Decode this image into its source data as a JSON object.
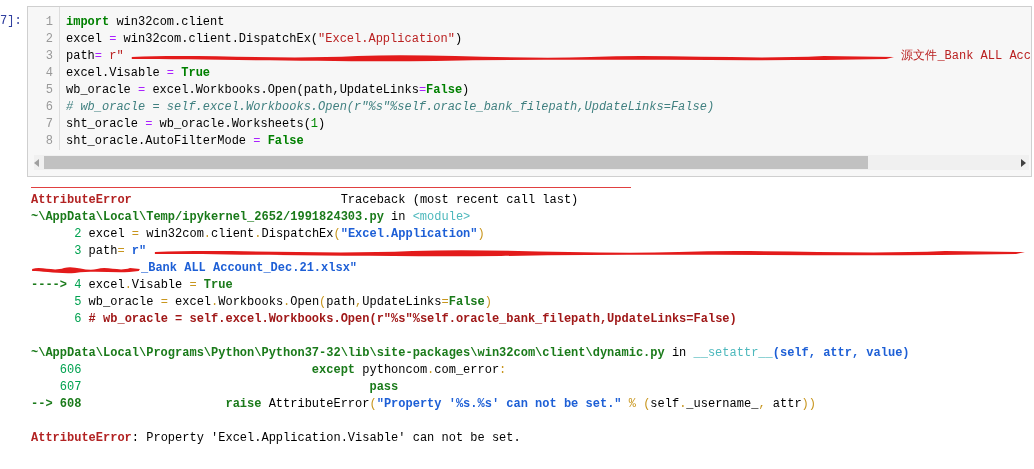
{
  "cell": {
    "prompt": "7]:",
    "lines": [
      {
        "number": "1",
        "tokens": [
          {
            "kind": "kw",
            "text": "import"
          },
          {
            "kind": "plain",
            "text": " win32com.client"
          }
        ]
      },
      {
        "number": "2",
        "tokens": [
          {
            "kind": "plain",
            "text": "excel "
          },
          {
            "kind": "op",
            "text": "="
          },
          {
            "kind": "plain",
            "text": " win32com.client.DispatchEx("
          },
          {
            "kind": "str",
            "text": "\"Excel.Application\""
          },
          {
            "kind": "plain",
            "text": ")"
          }
        ]
      },
      {
        "number": "3",
        "tokens": [
          {
            "kind": "plain",
            "text": "path"
          },
          {
            "kind": "op",
            "text": "="
          },
          {
            "kind": "str",
            "text": " r\""
          },
          {
            "kind": "redaction"
          },
          {
            "kind": "str",
            "text": "源文件_Bank ALL Acc"
          }
        ]
      },
      {
        "number": "4",
        "tokens": [
          {
            "kind": "plain",
            "text": "excel.Visable "
          },
          {
            "kind": "op",
            "text": "="
          },
          {
            "kind": "kw",
            "text": " True"
          }
        ]
      },
      {
        "number": "5",
        "tokens": [
          {
            "kind": "plain",
            "text": "wb_oracle "
          },
          {
            "kind": "op",
            "text": "="
          },
          {
            "kind": "plain",
            "text": " excel.Workbooks.Open(path,UpdateLinks"
          },
          {
            "kind": "op",
            "text": "="
          },
          {
            "kind": "kw",
            "text": "False"
          },
          {
            "kind": "plain",
            "text": ")"
          }
        ]
      },
      {
        "number": "6",
        "tokens": [
          {
            "kind": "com",
            "text": "# wb_oracle = self.excel.Workbooks.Open(r\"%s\"%self.oracle_bank_filepath,UpdateLinks=False)"
          }
        ]
      },
      {
        "number": "7",
        "tokens": [
          {
            "kind": "plain",
            "text": "sht_oracle "
          },
          {
            "kind": "op",
            "text": "="
          },
          {
            "kind": "plain",
            "text": " wb_oracle.Worksheets("
          },
          {
            "kind": "num",
            "text": "1"
          },
          {
            "kind": "plain",
            "text": ")"
          }
        ]
      },
      {
        "number": "8",
        "tokens": [
          {
            "kind": "plain",
            "text": "sht_oracle.AutoFilterMode "
          },
          {
            "kind": "op",
            "text": "="
          },
          {
            "kind": "kw",
            "text": " False"
          }
        ]
      }
    ]
  },
  "output": {
    "blocks": [
      {
        "lines": [
          {
            "tokens": [
              {
                "kind": "err",
                "text": "AttributeError"
              },
              {
                "kind": "plain",
                "text": "                             Traceback (most recent call last)"
              }
            ]
          },
          {
            "tokens": [
              {
                "kind": "path",
                "text": "~\\AppData\\Local\\Temp/ipykernel_2652/1991824303.py"
              },
              {
                "kind": "plain",
                "text": " in "
              },
              {
                "kind": "cyan",
                "text": "<module>"
              }
            ]
          },
          {
            "tokens": [
              {
                "kind": "lineno",
                "text": "      2"
              },
              {
                "kind": "plain",
                "text": " excel "
              },
              {
                "kind": "op",
                "text": "="
              },
              {
                "kind": "plain",
                "text": " win32com"
              },
              {
                "kind": "op",
                "text": "."
              },
              {
                "kind": "plain",
                "text": "client"
              },
              {
                "kind": "op",
                "text": "."
              },
              {
                "kind": "plain",
                "text": "DispatchEx"
              },
              {
                "kind": "op",
                "text": "("
              },
              {
                "kind": "str",
                "text": "\"Excel.Application\""
              },
              {
                "kind": "op",
                "text": ")"
              }
            ]
          },
          {
            "tokens": [
              {
                "kind": "lineno",
                "text": "      3"
              },
              {
                "kind": "plain",
                "text": " path"
              },
              {
                "kind": "op",
                "text": "="
              },
              {
                "kind": "str",
                "text": " r\""
              },
              {
                "kind": "redaction"
              }
            ]
          },
          {
            "tokens": [
              {
                "kind": "redaction"
              },
              {
                "kind": "str",
                "text": "_Bank ALL Account_Dec.21.xlsx\""
              }
            ]
          },
          {
            "tokens": [
              {
                "kind": "arrow",
                "text": "---->"
              },
              {
                "kind": "lineno",
                "text": " 4"
              },
              {
                "kind": "plain",
                "text": " excel"
              },
              {
                "kind": "op",
                "text": "."
              },
              {
                "kind": "plain",
                "text": "Visable "
              },
              {
                "kind": "op",
                "text": "="
              },
              {
                "kind": "kw",
                "text": " True"
              }
            ]
          },
          {
            "tokens": [
              {
                "kind": "lineno",
                "text": "      5"
              },
              {
                "kind": "plain",
                "text": " wb_oracle "
              },
              {
                "kind": "op",
                "text": "="
              },
              {
                "kind": "plain",
                "text": " excel"
              },
              {
                "kind": "op",
                "text": "."
              },
              {
                "kind": "plain",
                "text": "Workbooks"
              },
              {
                "kind": "op",
                "text": "."
              },
              {
                "kind": "plain",
                "text": "Open"
              },
              {
                "kind": "op",
                "text": "("
              },
              {
                "kind": "plain",
                "text": "path"
              },
              {
                "kind": "op",
                "text": ","
              },
              {
                "kind": "plain",
                "text": "UpdateLinks"
              },
              {
                "kind": "op",
                "text": "="
              },
              {
                "kind": "kw",
                "text": "False"
              },
              {
                "kind": "op",
                "text": ")"
              }
            ]
          },
          {
            "tokens": [
              {
                "kind": "lineno",
                "text": "      6"
              },
              {
                "kind": "com",
                "text": " # wb_oracle = self.excel.Workbooks.Open(r\"%s\"%self.oracle_bank_filepath,UpdateLinks=False)"
              }
            ]
          }
        ]
      },
      {
        "lines": [
          {
            "tokens": [
              {
                "kind": "path",
                "text": "~\\AppData\\Local\\Programs\\Python\\Python37-32\\lib\\site-packages\\win32com\\client\\dynamic.py"
              },
              {
                "kind": "plain",
                "text": " in "
              },
              {
                "kind": "cyan",
                "text": "__setattr__"
              },
              {
                "kind": "blue",
                "text": "(self, attr, value)"
              }
            ]
          },
          {
            "tokens": [
              {
                "kind": "lineno",
                "text": "    606"
              },
              {
                "kind": "kw",
                "text": "                                except"
              },
              {
                "kind": "plain",
                "text": " pythoncom"
              },
              {
                "kind": "op",
                "text": "."
              },
              {
                "kind": "plain",
                "text": "com_error"
              },
              {
                "kind": "op",
                "text": ":"
              }
            ]
          },
          {
            "tokens": [
              {
                "kind": "lineno",
                "text": "    607"
              },
              {
                "kind": "kw",
                "text": "                                        pass"
              }
            ]
          },
          {
            "tokens": [
              {
                "kind": "arrow",
                "text": "--> 608"
              },
              {
                "kind": "kw",
                "text": "                    raise"
              },
              {
                "kind": "plain",
                "text": " AttributeError"
              },
              {
                "kind": "op",
                "text": "("
              },
              {
                "kind": "str",
                "text": "\"Property '%s.%s' can not be set.\""
              },
              {
                "kind": "op",
                "text": " % ("
              },
              {
                "kind": "plain",
                "text": "self"
              },
              {
                "kind": "op",
                "text": "."
              },
              {
                "kind": "plain",
                "text": "_username_"
              },
              {
                "kind": "op",
                "text": ","
              },
              {
                "kind": "plain",
                "text": " attr"
              },
              {
                "kind": "op",
                "text": "))"
              }
            ]
          }
        ]
      },
      {
        "lines": [
          {
            "tokens": [
              {
                "kind": "err",
                "text": "AttributeError"
              },
              {
                "kind": "plain",
                "text": ": Property 'Excel.Application.Visable' can not be set."
              }
            ]
          }
        ]
      }
    ]
  }
}
